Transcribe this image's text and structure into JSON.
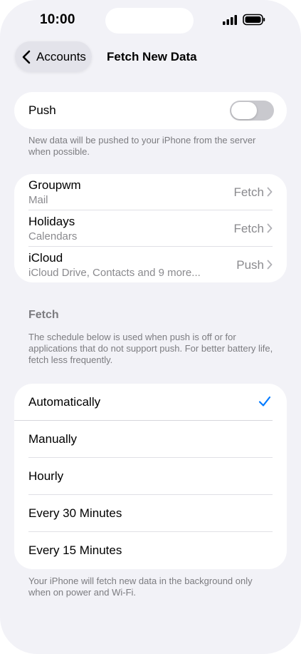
{
  "status_bar": {
    "time": "10:00"
  },
  "nav": {
    "back_label": "Accounts",
    "title": "Fetch New Data"
  },
  "push": {
    "label": "Push",
    "enabled": false,
    "footnote": "New data will be pushed to your iPhone from the server when possible."
  },
  "accounts": [
    {
      "name": "Groupwm",
      "services": "Mail",
      "mode": "Fetch"
    },
    {
      "name": "Holidays",
      "services": "Calendars",
      "mode": "Fetch"
    },
    {
      "name": "iCloud",
      "services": "iCloud Drive, Contacts and 9 more...",
      "mode": "Push"
    }
  ],
  "fetch": {
    "header": "Fetch",
    "description": "The schedule below is used when push is off or for applications that do not support push. For better battery life, fetch less frequently.",
    "options": [
      "Automatically",
      "Manually",
      "Hourly",
      "Every 30 Minutes",
      "Every 15 Minutes"
    ],
    "selected": "Automatically",
    "footnote": "Your iPhone will fetch new data in the background only when on power and Wi-Fi."
  },
  "colors": {
    "accent": "#007aff",
    "background": "#f2f2f7",
    "secondary_text": "#8a8a8e"
  },
  "icons": {
    "back": "chevron-left-icon",
    "disclosure": "chevron-right-icon",
    "selected": "checkmark-icon"
  }
}
